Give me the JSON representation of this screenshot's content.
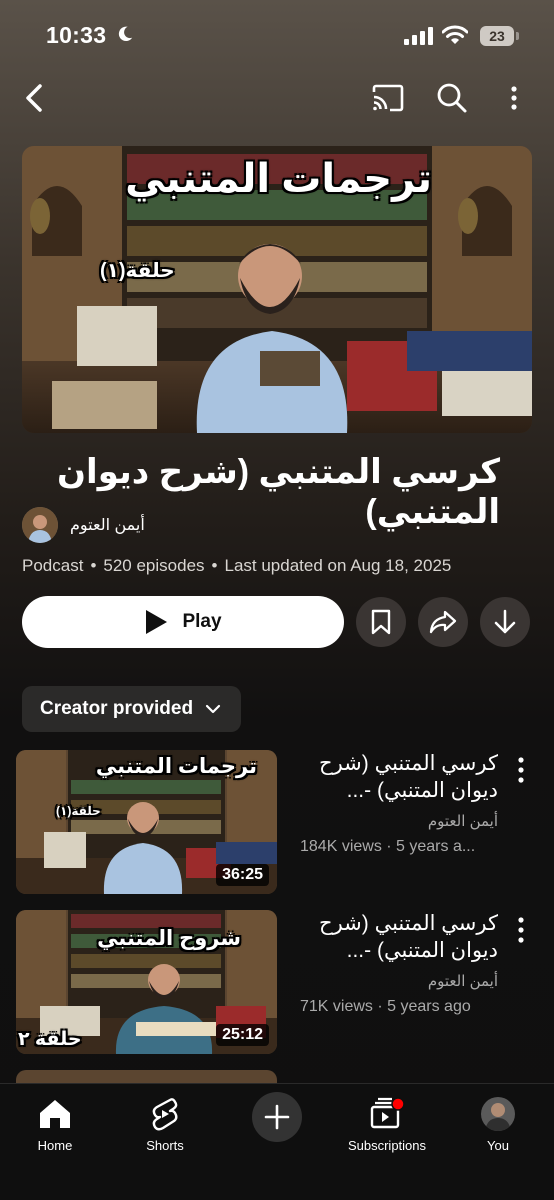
{
  "status_bar": {
    "time": "10:33",
    "battery": "23"
  },
  "playlist": {
    "hero_overlay_title": "ترجمات المتنبي",
    "hero_overlay_episode": "حلقة(١)",
    "title": "كرسي المتنبي (شرح ديوان المتنبي)",
    "channel": "أيمن العتوم",
    "meta": {
      "type": "Podcast",
      "episodes": "520 episodes",
      "updated": "Last updated on Aug 18, 2025"
    },
    "play_label": "Play"
  },
  "filter_chip": "Creator provided",
  "episodes": [
    {
      "title": "كرسي المتنبي (شرح ديوان المتنبي) -...",
      "channel": "أيمن العتوم",
      "stats": "184K views · 5 years a...",
      "duration": "36:25",
      "overlay_title": "ترجمات المتنبي",
      "overlay_sub": "حلقة(١)"
    },
    {
      "title": "كرسي المتنبي (شرح ديوان المتنبي) -...",
      "channel": "أيمن العتوم",
      "stats": "71K views · 5 years ago",
      "duration": "25:12",
      "overlay_title": "شروح المتنبي",
      "overlay_sub": "حلقة ٢"
    }
  ],
  "nav": [
    {
      "label": "Home",
      "icon": "home-icon"
    },
    {
      "label": "Shorts",
      "icon": "shorts-icon"
    },
    {
      "label": "",
      "icon": "create-icon"
    },
    {
      "label": "Subscriptions",
      "icon": "subscriptions-icon"
    },
    {
      "label": "You",
      "icon": "avatar"
    }
  ],
  "colors": {
    "accent_red": "#ff0000",
    "background": "#0f0f0f",
    "button_bg": "#3a3533"
  }
}
